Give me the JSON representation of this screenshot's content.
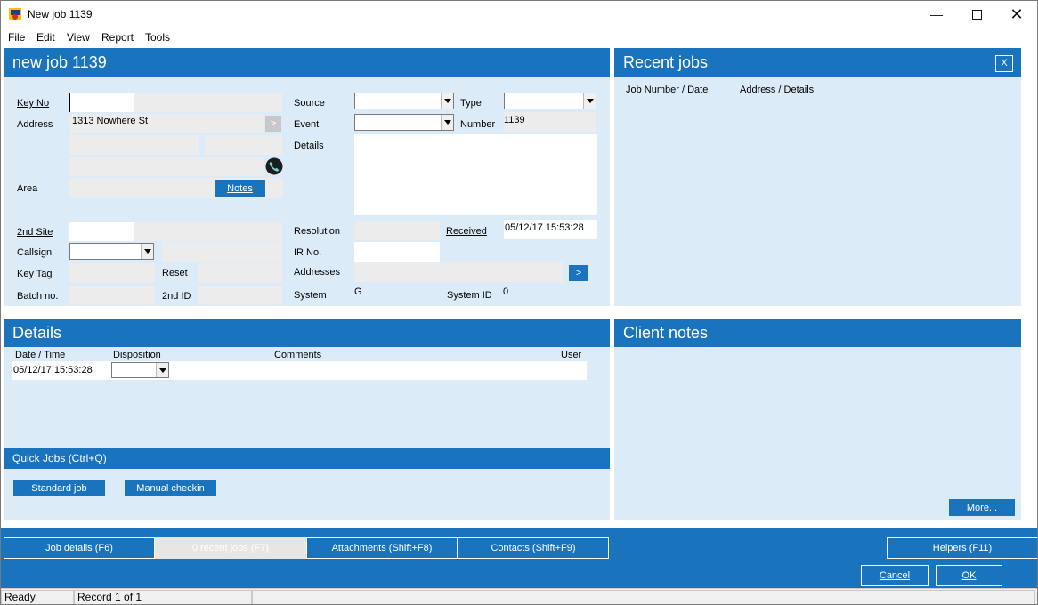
{
  "window": {
    "title": "New job 1139"
  },
  "menu": [
    "File",
    "Edit",
    "View",
    "Report",
    "Tools"
  ],
  "job_panel": {
    "heading": "new job 1139",
    "key_no_label": "Key No",
    "address_label": "Address",
    "address_value": "1313 Nowhere St",
    "address_more": ">",
    "area_label": "Area",
    "notes_button": "Notes",
    "source_label": "Source",
    "type_label": "Type",
    "event_label": "Event",
    "number_label": "Number",
    "number_value": "1139",
    "details_label": "Details",
    "second_site_label": "2nd Site",
    "resolution_label": "Resolution",
    "received_label": "Received",
    "received_value": "05/12/17 15:53:28",
    "callsign_label": "Callsign",
    "ir_label": "IR No.",
    "key_tag_label": "Key Tag",
    "reset_label": "Reset",
    "addresses_label": "Addresses",
    "addresses_button": ">",
    "batch_label": "Batch no.",
    "second_id_label": "2nd ID",
    "system_label": "System",
    "system_value": "G",
    "system_id_label": "System ID",
    "system_id_value": "0"
  },
  "recent_jobs": {
    "heading": "Recent jobs",
    "close": "X",
    "col1": "Job Number / Date",
    "col2": "Address / Details",
    "more_button": "More..."
  },
  "details_panel": {
    "heading": "Details",
    "col_datetime": "Date / Time",
    "col_disposition": "Disposition",
    "col_comments": "Comments",
    "col_user": "User",
    "row_datetime": "05/12/17 15:53:28"
  },
  "quick_jobs": {
    "heading": "Quick Jobs (Ctrl+Q)",
    "btn1": "Standard job",
    "btn2": "Manual checkin"
  },
  "client_notes": {
    "heading": "Client notes"
  },
  "tabs": {
    "job_details": "Job details (F6)",
    "recent_jobs": "0 recent jobs (F7)",
    "attachments": "Attachments (Shift+F8)",
    "contacts": "Contacts (Shift+F9)",
    "helpers": "Helpers (F11)"
  },
  "actions": {
    "cancel": "Cancel",
    "ok": "OK"
  },
  "status": {
    "ready": "Ready",
    "record": "Record 1 of 1"
  }
}
